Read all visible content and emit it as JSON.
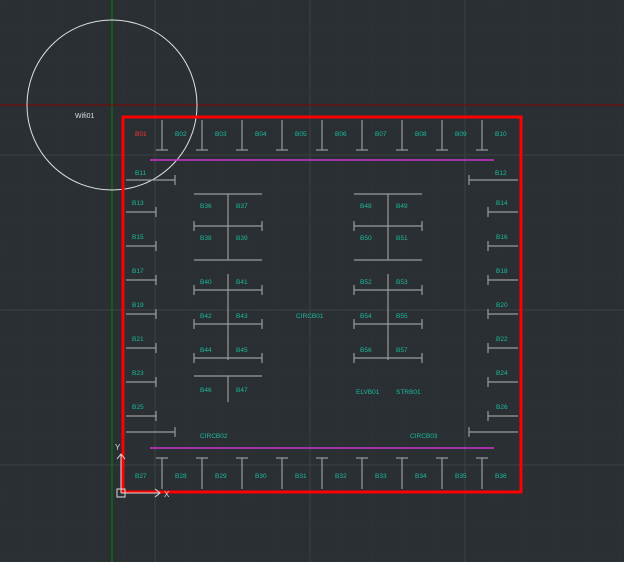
{
  "wifi_label": "Wifi01",
  "circb_labels": [
    "CIRCB01",
    "CIRCB02",
    "CIRCB03"
  ],
  "elvb_label": "ELVB01",
  "strb_label": "STRB01",
  "axis_x": "X",
  "axis_y": "Y",
  "top_row": [
    "B01",
    "B02",
    "B03",
    "B04",
    "B05",
    "B06",
    "B07",
    "B08",
    "B09",
    "B10"
  ],
  "bottom_row": [
    "B27",
    "B28",
    "B29",
    "B30",
    "B31",
    "B32",
    "B33",
    "B34",
    "B35",
    "B36"
  ],
  "left_col": [
    "B11",
    "B13",
    "B15",
    "B17",
    "B19",
    "B21",
    "B23",
    "B25"
  ],
  "right_col": [
    "B12",
    "B14",
    "B16",
    "B18",
    "B20",
    "B22",
    "B24",
    "B26"
  ],
  "core_L1": [
    "B36",
    "B37"
  ],
  "core_L2": [
    "B38",
    "B39"
  ],
  "core_L3": [
    "B40",
    "B41"
  ],
  "core_L4": [
    "B42",
    "B43"
  ],
  "core_L5": [
    "B44",
    "B45"
  ],
  "core_L6": [
    "B46",
    "B47"
  ],
  "core_R1": [
    "B48",
    "B49"
  ],
  "core_R2": [
    "B50",
    "B51"
  ],
  "core_R3": [
    "B52",
    "B53"
  ],
  "core_R4": [
    "B54",
    "B55"
  ],
  "core_R5": [
    "B56",
    "B57"
  ],
  "colors": {
    "bg": "#2a2f33",
    "outline": "#ff0000",
    "slot": "#9a9a9a",
    "beam": "#cc33cc",
    "label": "#1abc9c"
  }
}
